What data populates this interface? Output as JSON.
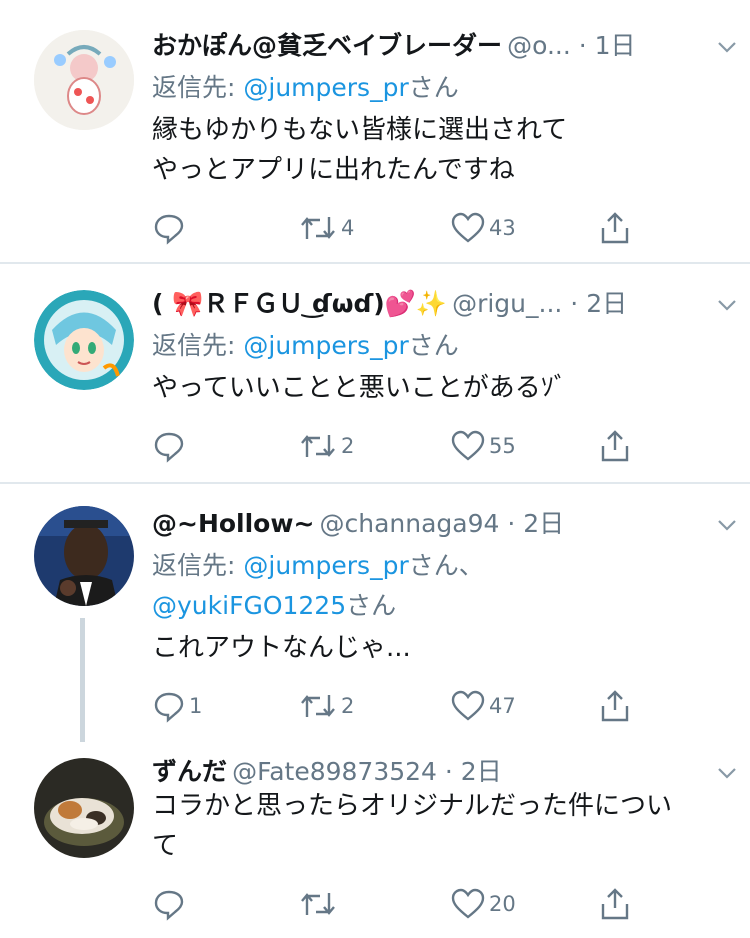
{
  "tweets": [
    {
      "name": "おかぽん@貧乏ベイブレーダー",
      "handle_time": "@o... · 1日",
      "reply_prefix": "返信先: ",
      "reply_mentions": "@jumpers_pr",
      "reply_suffix": "さん",
      "body_lines": [
        "縁もゆかりもない皆様に選出されて",
        "やっとアプリに出れたんですね"
      ],
      "replies": "",
      "retweets": "4",
      "likes": "43"
    },
    {
      "name": "( 🎀ＲＦＧＵ ͜ɗωɗ)💕✨",
      "handle_time": "@rigu_... · 2日",
      "reply_prefix": "返信先: ",
      "reply_mentions": "@jumpers_pr",
      "reply_suffix": "さん",
      "body_lines": [
        "やっていいことと悪いことがあるｿﾞ"
      ],
      "replies": "",
      "retweets": "2",
      "likes": "55"
    },
    {
      "name": "@~Hollow~",
      "handle_time": "@channaga94 · 2日",
      "reply_prefix": "返信先: ",
      "reply_mentions": "@jumpers_pr",
      "reply_suffix": "さん、",
      "reply_mentions2": "@yukiFGO1225",
      "reply_suffix2": "さん",
      "body_lines": [
        "これアウトなんじゃ..."
      ],
      "replies": "1",
      "retweets": "2",
      "likes": "47"
    },
    {
      "name": "ずんだ",
      "handle_time": "@Fate89873524 · 2日",
      "body_lines": [
        "コラかと思ったらオリジナルだった件につい",
        "て"
      ],
      "replies": "",
      "retweets": "",
      "likes": "20"
    }
  ],
  "icons": {
    "reply": "reply-icon",
    "retweet": "retweet-icon",
    "like": "heart-icon",
    "share": "share-icon",
    "caret": "chevron-down-icon"
  },
  "colors": {
    "text": "#14171a",
    "secondary": "#657786",
    "link": "#1b95e0",
    "divider": "#e1e8ed",
    "thread_line": "#ccd6dd"
  }
}
